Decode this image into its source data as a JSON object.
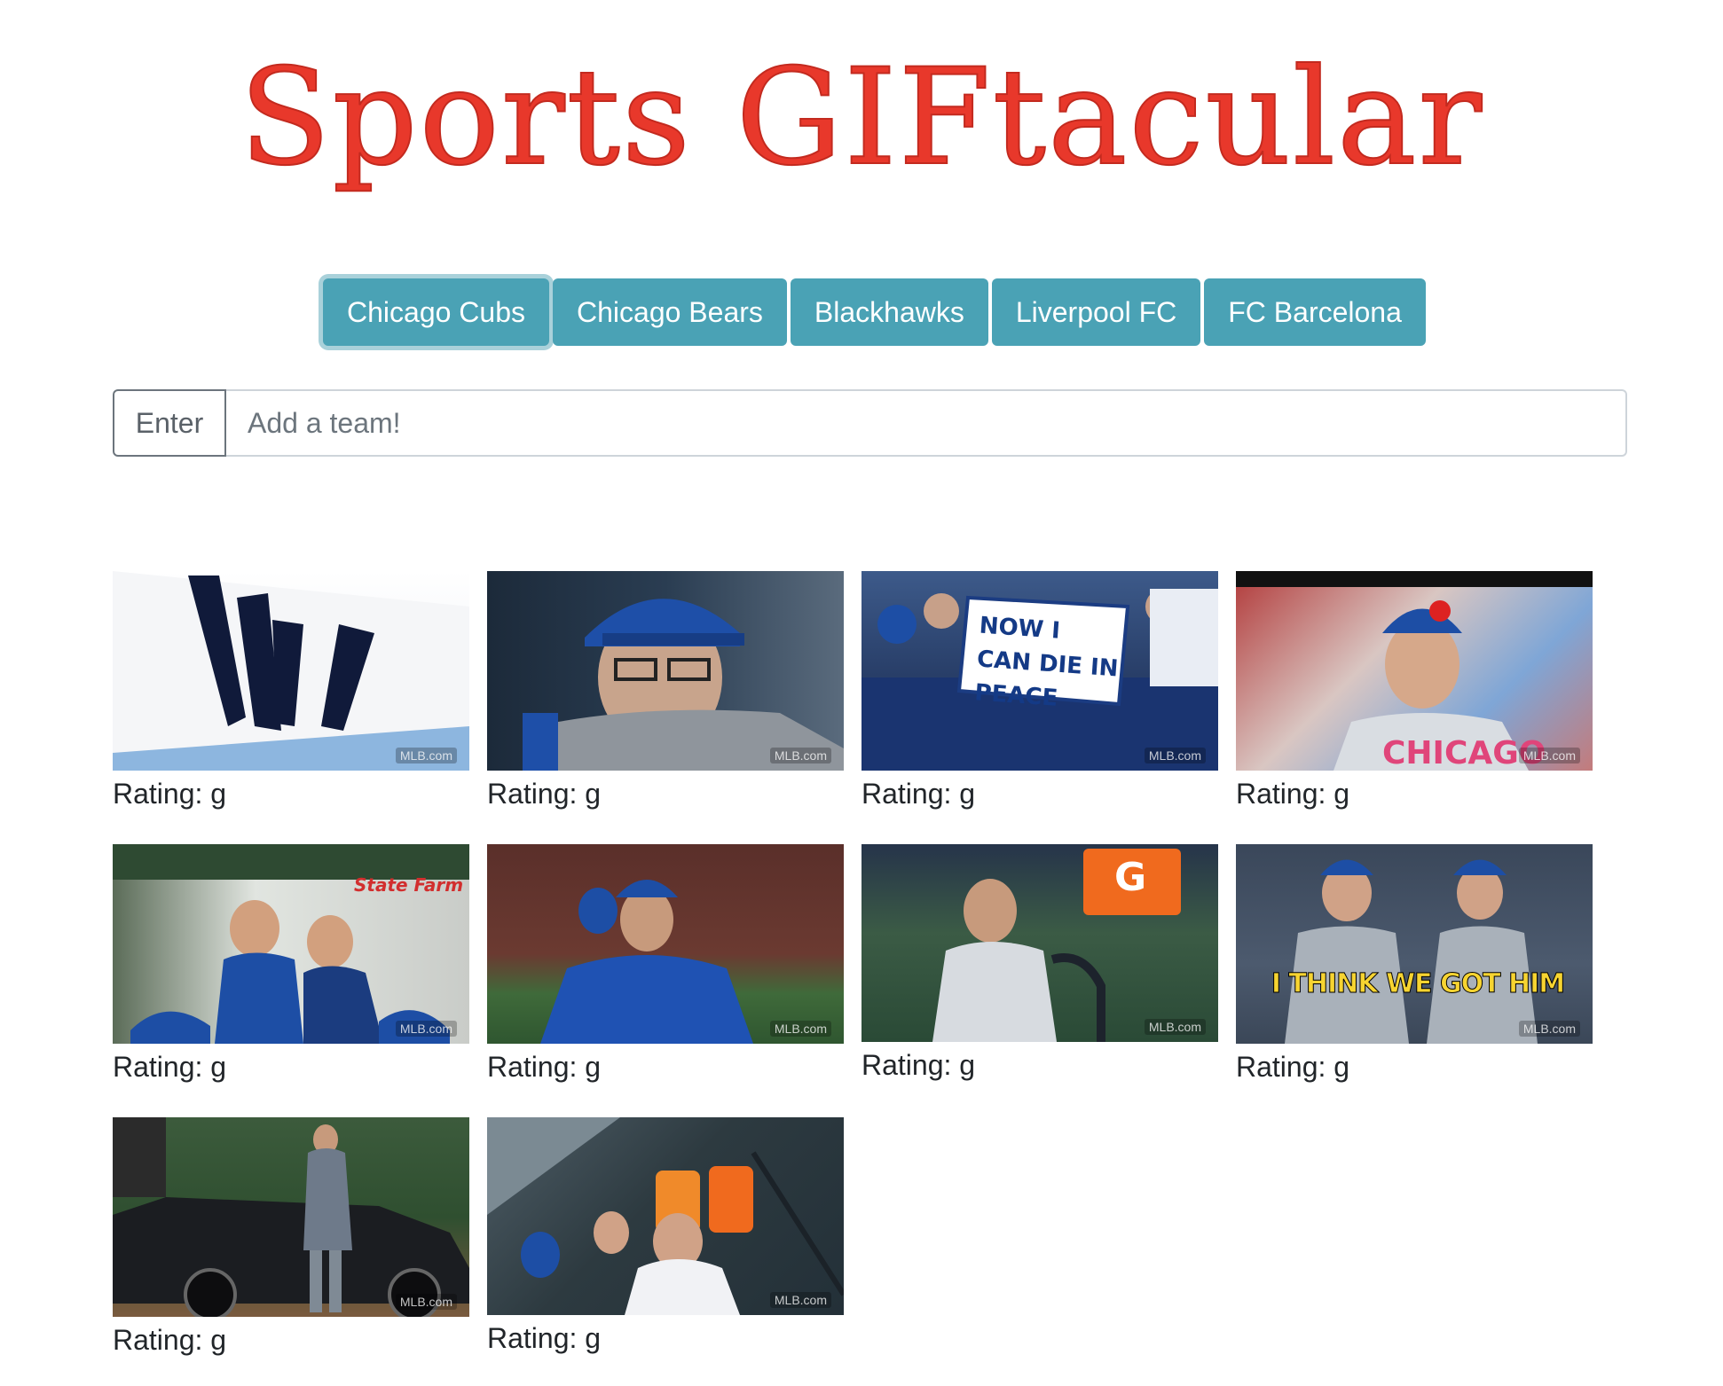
{
  "header": {
    "title": "Sports GIFtacular"
  },
  "teams": [
    {
      "label": "Chicago Cubs",
      "active": true
    },
    {
      "label": "Chicago Bears",
      "active": false
    },
    {
      "label": "Blackhawks",
      "active": false
    },
    {
      "label": "Liverpool FC",
      "active": false
    },
    {
      "label": "FC Barcelona",
      "active": false
    }
  ],
  "search": {
    "button_label": "Enter",
    "placeholder": "Add a team!",
    "value": ""
  },
  "gifs": [
    {
      "rating_label": "Rating: g",
      "watermark": "MLB.com",
      "overlay": ""
    },
    {
      "rating_label": "Rating: g",
      "watermark": "MLB.com",
      "overlay": ""
    },
    {
      "rating_label": "Rating: g",
      "watermark": "MLB.com",
      "overlay": "NOW I CAN DIE IN PEACE"
    },
    {
      "rating_label": "Rating: g",
      "watermark": "MLB.com",
      "overlay": "CHICAGO"
    },
    {
      "rating_label": "Rating: g",
      "watermark": "MLB.com",
      "overlay": "State Farm"
    },
    {
      "rating_label": "Rating: g",
      "watermark": "MLB.com",
      "overlay": ""
    },
    {
      "rating_label": "Rating: g",
      "watermark": "MLB.com",
      "overlay": "G"
    },
    {
      "rating_label": "Rating: g",
      "watermark": "MLB.com",
      "overlay": "I THINK WE GOT HIM"
    },
    {
      "rating_label": "Rating: g",
      "watermark": "MLB.com",
      "overlay": ""
    },
    {
      "rating_label": "Rating: g",
      "watermark": "MLB.com",
      "overlay": ""
    }
  ],
  "colors": {
    "title": "#e8382b",
    "button": "#4aa2b5",
    "button_text": "#ffffff"
  }
}
